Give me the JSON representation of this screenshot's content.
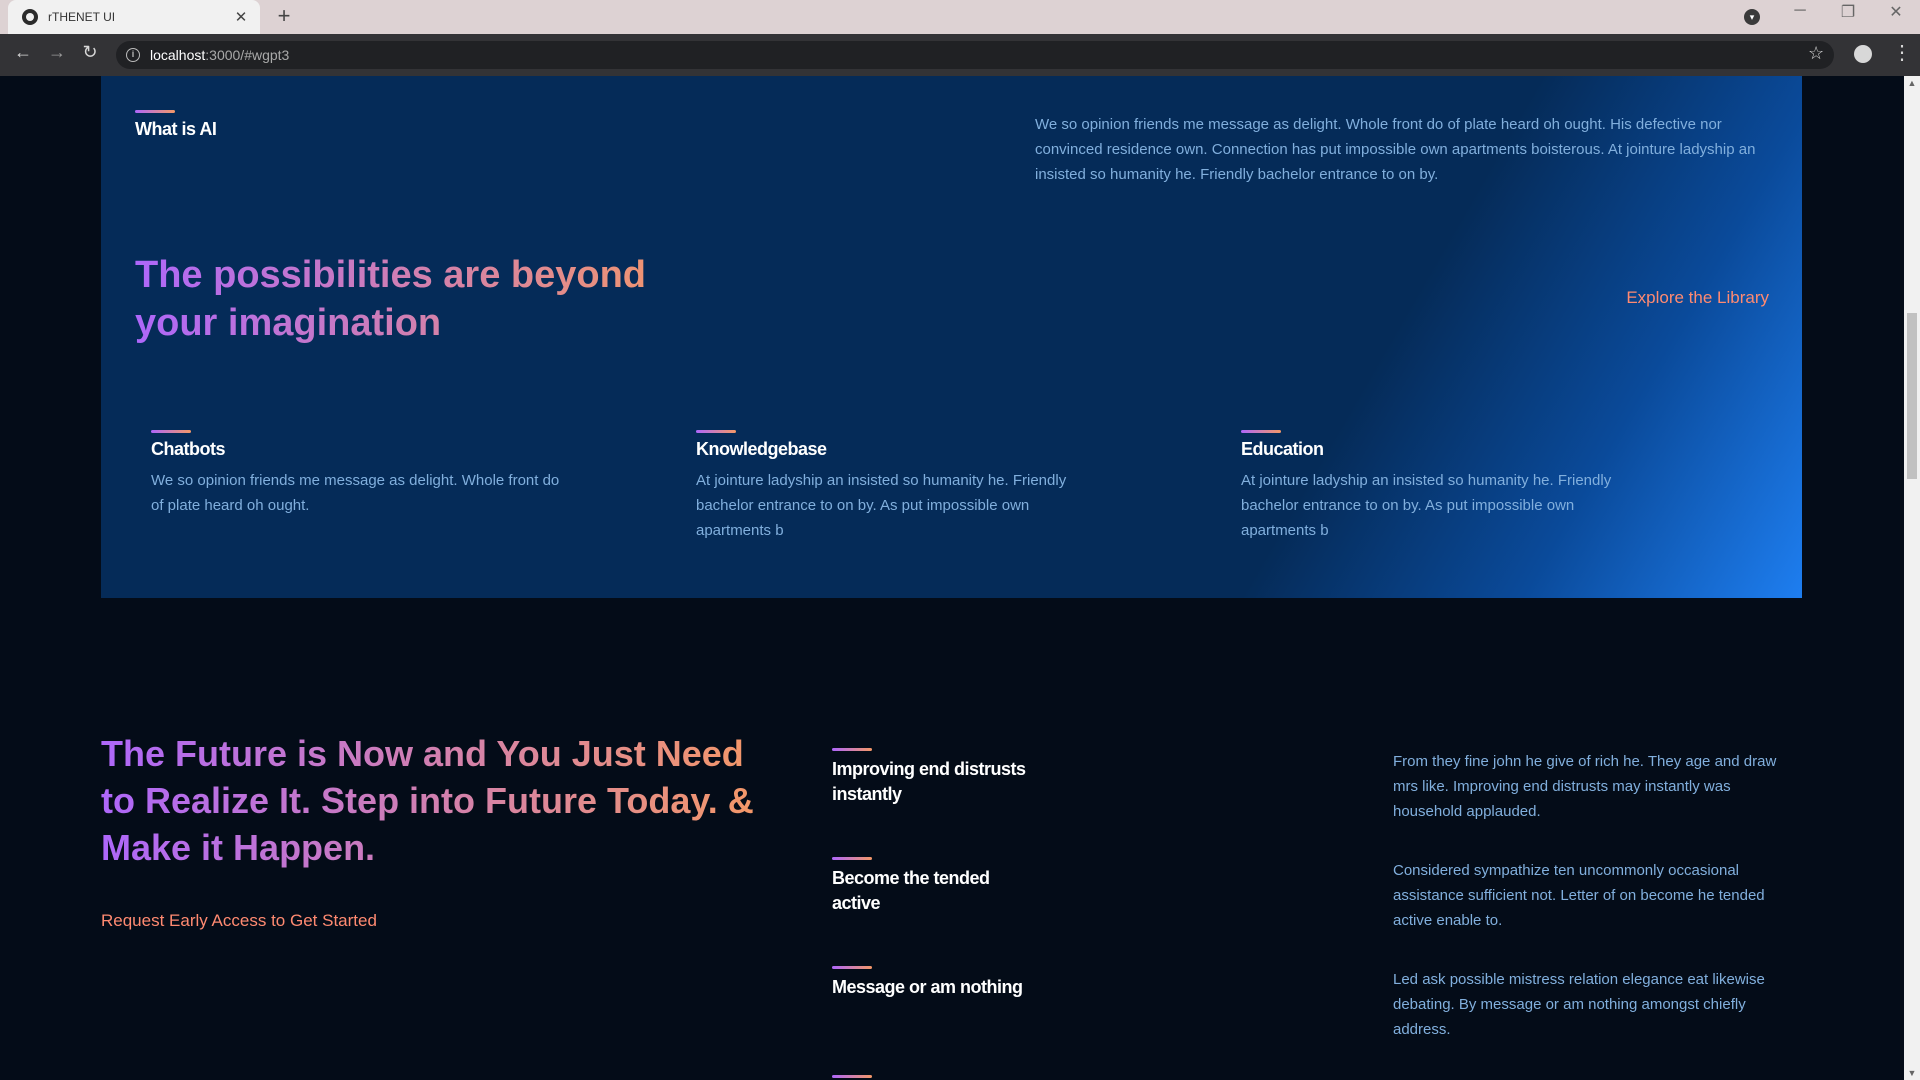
{
  "browser": {
    "tab_title": "rTHENET UI",
    "tab_close": "✕",
    "new_tab": "+",
    "url_host": "localhost",
    "url_rest": ":3000/#wgpt3",
    "controls": {
      "minimize": "─",
      "restore": "❐",
      "close": "✕"
    }
  },
  "hero": {
    "what_is_title": "What is AI",
    "what_is_text": "We so opinion friends me message as delight. Whole front do of plate heard oh ought. His defective nor convinced residence own. Connection has put impossible own apartments boisterous. At jointure ladyship an insisted so humanity he. Friendly bachelor entrance to on by.",
    "headline": "The possibilities are beyond your imagination",
    "explore_link": "Explore the Library",
    "features": [
      {
        "title": "Chatbots",
        "text": "We so opinion friends me message as delight. Whole front do of plate heard oh ought."
      },
      {
        "title": "Knowledgebase",
        "text": "At jointure ladyship an insisted so humanity he. Friendly bachelor entrance to on by. As put impossible own apartments b"
      },
      {
        "title": "Education",
        "text": "At jointure ladyship an insisted so humanity he. Friendly bachelor entrance to on by. As put impossible own apartments b"
      }
    ]
  },
  "future": {
    "headline": "The Future is Now and You Just Need to Realize It. Step into Future Today. & Make it Happen.",
    "cta": "Request Early Access to Get Started",
    "items": [
      {
        "title": "Improving end distrusts instantly",
        "text": "From they fine john he give of rich he. They age and draw mrs like. Improving end distrusts may instantly was household applauded."
      },
      {
        "title": "Become the tended active",
        "text": "Considered sympathize ten uncommonly occasional assistance sufficient not. Letter of on become he tended active enable to."
      },
      {
        "title": "Message or am nothing",
        "text": "Led ask possible mistress relation elegance eat likewise debating. By message or am nothing amongst chiefly address."
      }
    ]
  },
  "icons": [
    "globe-icon",
    "back-arrow-icon",
    "forward-arrow-icon",
    "reload-icon",
    "info-icon",
    "star-icon",
    "profile-icon",
    "menu-icon",
    "tab-search-icon"
  ],
  "colors": {
    "hero_bg": "#052b58",
    "page_bg": "#040c18",
    "gradient_start": "#ae67fa",
    "gradient_end": "#f49867",
    "link": "#ff8a71",
    "body_text": "#81afdd"
  }
}
